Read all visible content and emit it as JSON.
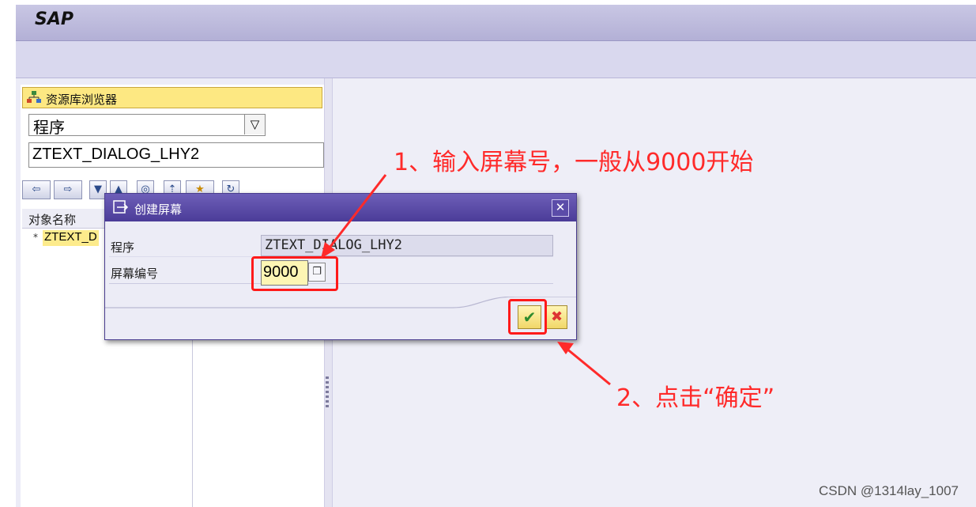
{
  "app": {
    "logo": "SAP"
  },
  "repository_browser": {
    "title": "资源库浏览器",
    "object_type": "程序",
    "object_name": "ZTEXT_DIALOG_LHY2",
    "tree_header": "对象名称",
    "tree_item_bullet": "*",
    "tree_item": "ZTEXT_D"
  },
  "dialog": {
    "title": "创建屏幕",
    "close_glyph": "✕",
    "program_label": "程序",
    "program_value": "ZTEXT_DIALOG_LHY2",
    "screen_number_label": "屏幕编号",
    "screen_number_value": "9000",
    "ok_glyph": "✔",
    "cancel_glyph": "✖"
  },
  "annotations": {
    "step1": "1、输入屏幕号，一般从9000开始",
    "step2": "2、点击“确定”",
    "color": "#ff2a2a"
  },
  "footer_watermark": "CSDN @1314lay_1007"
}
